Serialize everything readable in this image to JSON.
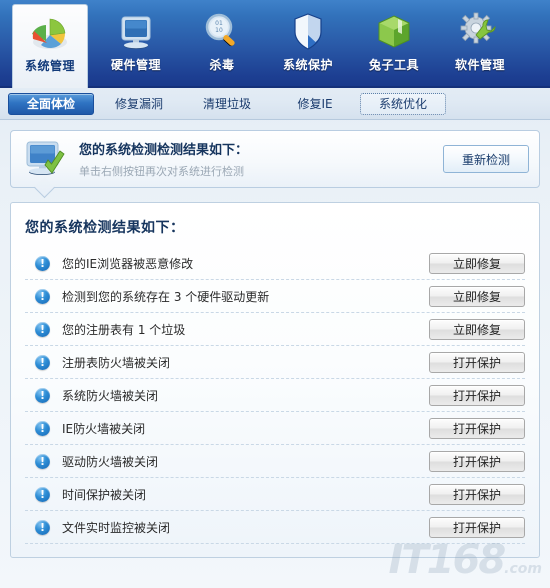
{
  "header": {
    "nav_items": [
      {
        "label": "系统管理",
        "icon": "pie-chart-icon",
        "active": true
      },
      {
        "label": "硬件管理",
        "icon": "monitor-icon",
        "active": false
      },
      {
        "label": "杀毒",
        "icon": "magnifier-icon",
        "active": false
      },
      {
        "label": "系统保护",
        "icon": "shield-icon",
        "active": false
      },
      {
        "label": "兔子工具",
        "icon": "green-box-icon",
        "active": false
      },
      {
        "label": "软件管理",
        "icon": "gear-wrench-icon",
        "active": false
      }
    ]
  },
  "tabs": [
    {
      "label": "全面体检",
      "state": "active"
    },
    {
      "label": "修复漏洞",
      "state": "normal"
    },
    {
      "label": "清理垃圾",
      "state": "normal"
    },
    {
      "label": "修复IE",
      "state": "normal"
    },
    {
      "label": "系统优化",
      "state": "focused"
    }
  ],
  "info_panel": {
    "icon": "monitor-check-icon",
    "title": "您的系统检测检测结果如下：",
    "subtitle": "单击右侧按钮再次对系统进行检测",
    "rescan_button": "重新检测"
  },
  "results": {
    "title": "您的系统检测结果如下：",
    "rows": [
      {
        "icon": "warning-icon",
        "text": "您的IE浏览器被恶意修改",
        "action": "立即修复"
      },
      {
        "icon": "warning-icon",
        "text": "检测到您的系统存在 3 个硬件驱动更新",
        "action": "立即修复"
      },
      {
        "icon": "warning-icon",
        "text": "您的注册表有 1 个垃圾",
        "action": "立即修复"
      },
      {
        "icon": "warning-icon",
        "text": "注册表防火墙被关闭",
        "action": "打开保护"
      },
      {
        "icon": "warning-icon",
        "text": "系统防火墙被关闭",
        "action": "打开保护"
      },
      {
        "icon": "warning-icon",
        "text": "IE防火墙被关闭",
        "action": "打开保护"
      },
      {
        "icon": "warning-icon",
        "text": "驱动防火墙被关闭",
        "action": "打开保护"
      },
      {
        "icon": "warning-icon",
        "text": "时间保护被关闭",
        "action": "打开保护"
      },
      {
        "icon": "warning-icon",
        "text": "文件实时监控被关闭",
        "action": "打开保护"
      }
    ]
  },
  "watermark": {
    "text": "IT168",
    "suffix": ".com"
  },
  "colors": {
    "header_top": "#3f82ca",
    "header_bottom": "#1a3a8c",
    "tab_active": "#2f73c2",
    "warning_blue": "#1666b4",
    "text_dark": "#16355e"
  }
}
